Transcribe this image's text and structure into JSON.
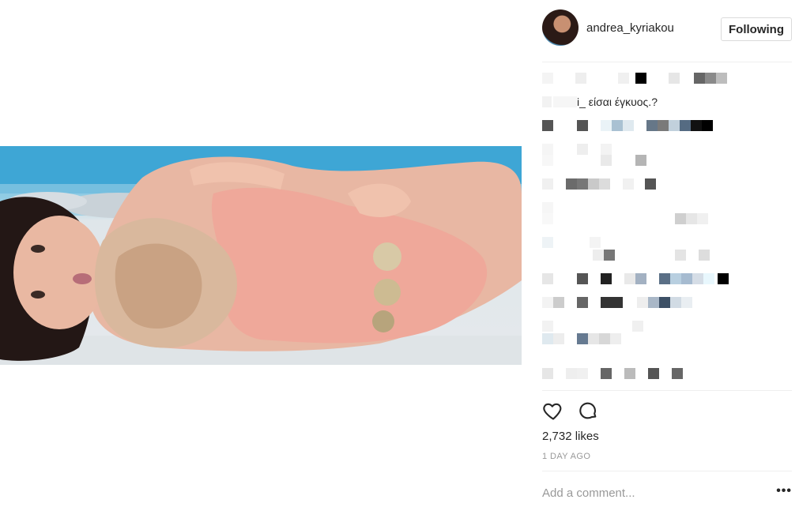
{
  "post": {
    "username": "andrea_kyriakou",
    "follow_label": "Following",
    "likes": "2,732 likes",
    "timestamp": "1 DAY AGO",
    "add_comment_placeholder": "Add a comment...",
    "more_label": "•••"
  },
  "comments": {
    "visible_text_1": "i_ είσαι έγκυος.?"
  },
  "colors": {
    "text": "#262626",
    "muted": "#999999",
    "border": "#dbdbdb"
  },
  "icons": {
    "like": "heart-outline",
    "comment": "speech-bubble-outline",
    "more": "ellipsis"
  }
}
